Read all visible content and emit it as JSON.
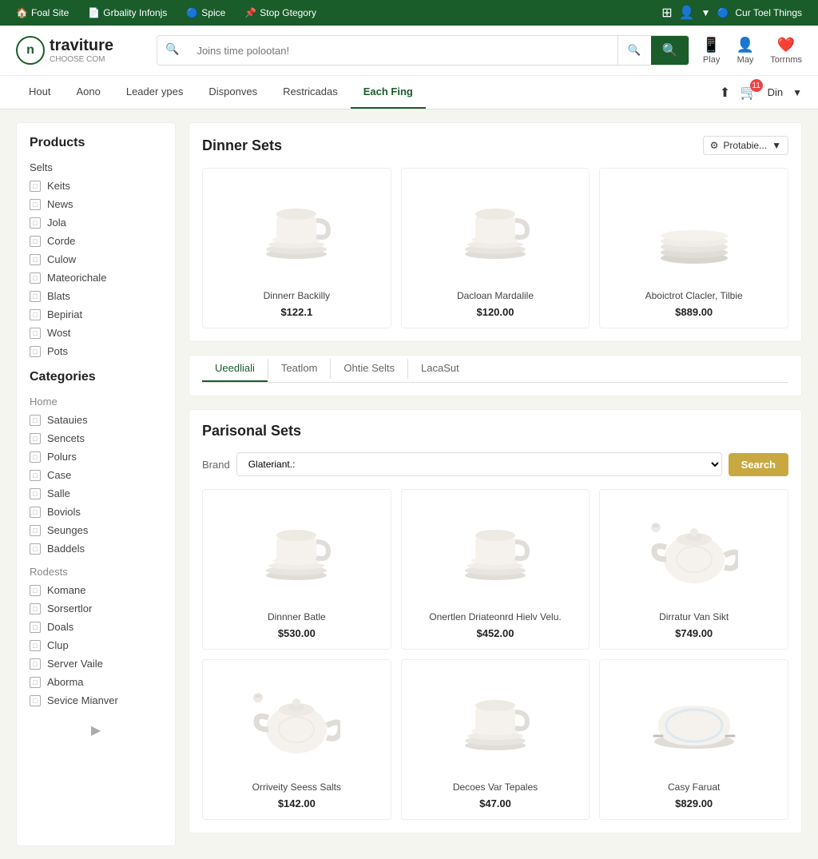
{
  "topbar": {
    "items": [
      {
        "label": "Foal Site",
        "icon": "🏠"
      },
      {
        "label": "Grbality Infonjs",
        "icon": "📄"
      },
      {
        "label": "Spice",
        "icon": "🔵"
      },
      {
        "label": "Stop Gtegory",
        "icon": "📌"
      }
    ],
    "right_items": [
      {
        "label": "Cur Toel Things",
        "icon": "🔵"
      }
    ]
  },
  "header": {
    "logo_letter": "n",
    "logo_name": "traviture",
    "logo_sub": "CHOOSE COM",
    "search_placeholder": "Joins time polootan!",
    "actions": [
      {
        "label": "Play",
        "icon": "📱"
      },
      {
        "label": "May",
        "icon": "👤"
      },
      {
        "label": "Torrnms",
        "icon": "❤️"
      }
    ]
  },
  "nav": {
    "items": [
      {
        "label": "Hout",
        "active": false
      },
      {
        "label": "Aono",
        "active": false
      },
      {
        "label": "Leader ypes",
        "active": false
      },
      {
        "label": "Disponves",
        "active": false
      },
      {
        "label": "Restricadas",
        "active": false
      },
      {
        "label": "Each Fing",
        "active": true
      }
    ],
    "cart_count": "11"
  },
  "sidebar": {
    "products_title": "Products",
    "products_section": "Selts",
    "products_items": [
      {
        "label": "Keits"
      },
      {
        "label": "News"
      },
      {
        "label": "Jola"
      },
      {
        "label": "Corde"
      },
      {
        "label": "Culow"
      },
      {
        "label": "Mateorichale"
      },
      {
        "label": "Blats"
      },
      {
        "label": "Bepiriat"
      },
      {
        "label": "Wost"
      },
      {
        "label": "Pots"
      }
    ],
    "categories_title": "Categories",
    "categories_sections": [
      {
        "label": "Home",
        "items": [
          "Satauies",
          "Sencets",
          "Polurs",
          "Case",
          "Salle",
          "Boviols",
          "Seunges",
          "Baddels"
        ]
      },
      {
        "label": "Rodests",
        "items": [
          "Komane",
          "Sorsertlor",
          "Doals",
          "Clup",
          "Server Vaile",
          "Aborma",
          "Sevice Mianver"
        ]
      }
    ]
  },
  "dinner_sets": {
    "title": "Dinner Sets",
    "sort_label": "Protabie...",
    "products": [
      {
        "name": "Dinnerr Backilly",
        "price": "$122.1"
      },
      {
        "name": "Dacloan Mardalile",
        "price": "$120.00"
      },
      {
        "name": "Aboictrot Clacler, Tilbie",
        "price": "$889.00"
      }
    ]
  },
  "tabs": [
    {
      "label": "Ueedliali",
      "active": true
    },
    {
      "label": "Teatlom",
      "active": false
    },
    {
      "label": "Ohtie Selts",
      "active": false
    },
    {
      "label": "LacaSut",
      "active": false
    }
  ],
  "parisonal_sets": {
    "title": "Parisonal Sets",
    "filter_label": "Brand",
    "filter_placeholder": "Glateriant.:",
    "search_btn": "Search",
    "products": [
      {
        "name": "Dinnner Batle",
        "price": "$530.00"
      },
      {
        "name": "Onertlen Driateonrd Hielv Velu.",
        "price": "$452.00"
      },
      {
        "name": "Dirratur Van Sikt",
        "price": "$749.00"
      },
      {
        "name": "Orriveity Seess Salts",
        "price": "$142.00"
      },
      {
        "name": "Decoes Var Tepales",
        "price": "$47.00"
      },
      {
        "name": "Casy Faruat",
        "price": "$829.00"
      }
    ]
  }
}
